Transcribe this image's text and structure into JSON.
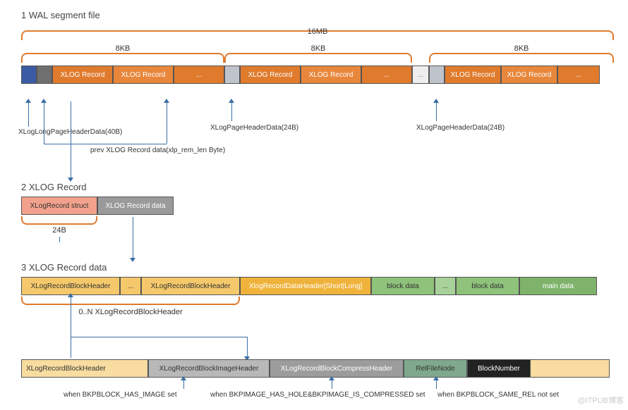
{
  "section1": {
    "title": "1 WAL segment file",
    "topBrace": "16MB",
    "subBraces": [
      "8KB",
      "8KB",
      "8KB"
    ],
    "row": {
      "hdr_long": "",
      "hdr_tail": "",
      "rec": "XLOG Record",
      "dots": "...",
      "hdr_short": "",
      "gap": "..."
    },
    "labels": {
      "long_header": "XLogLongPageHeaderData(40B)",
      "prev_rec": "prev XLOG Record data(xlp_rem_len Byte)",
      "short_header1": "XLogPageHeaderData(24B)",
      "short_header2": "XLogPageHeaderData(24B)"
    }
  },
  "section2": {
    "title": "2 XLOG Record",
    "struct": "XLogRecord struct",
    "data": "XLOG Record data",
    "brace": "24B"
  },
  "section3": {
    "title": "3 XLOG Record data",
    "blocks": {
      "bh": "XLogRecordBlockHeader",
      "dots": "...",
      "dh": "XlogRecordDataHeader[Short|Long]",
      "bd": "block data",
      "md": "main data"
    },
    "brace": "0..N XLogRecordBlockHeader"
  },
  "section4": {
    "title": "XLogRecordBlockHeader",
    "blocks": {
      "img": "XLogRecordBlockImageHeader",
      "cmp": "XLogRecordBlockCompressHeader",
      "rel": "RelFileNode",
      "blk": "BlockNumber"
    },
    "notes": {
      "when_image": "when BKPBLOCK_HAS_IMAGE set",
      "when_hole": "when BKPIMAGE_HAS_HOLE&BKPIMAGE_IS_COMPRESSED set",
      "when_same": "when BKPBLOCK_SAME_REL not set"
    }
  },
  "watermark": "@ITPUB博客"
}
